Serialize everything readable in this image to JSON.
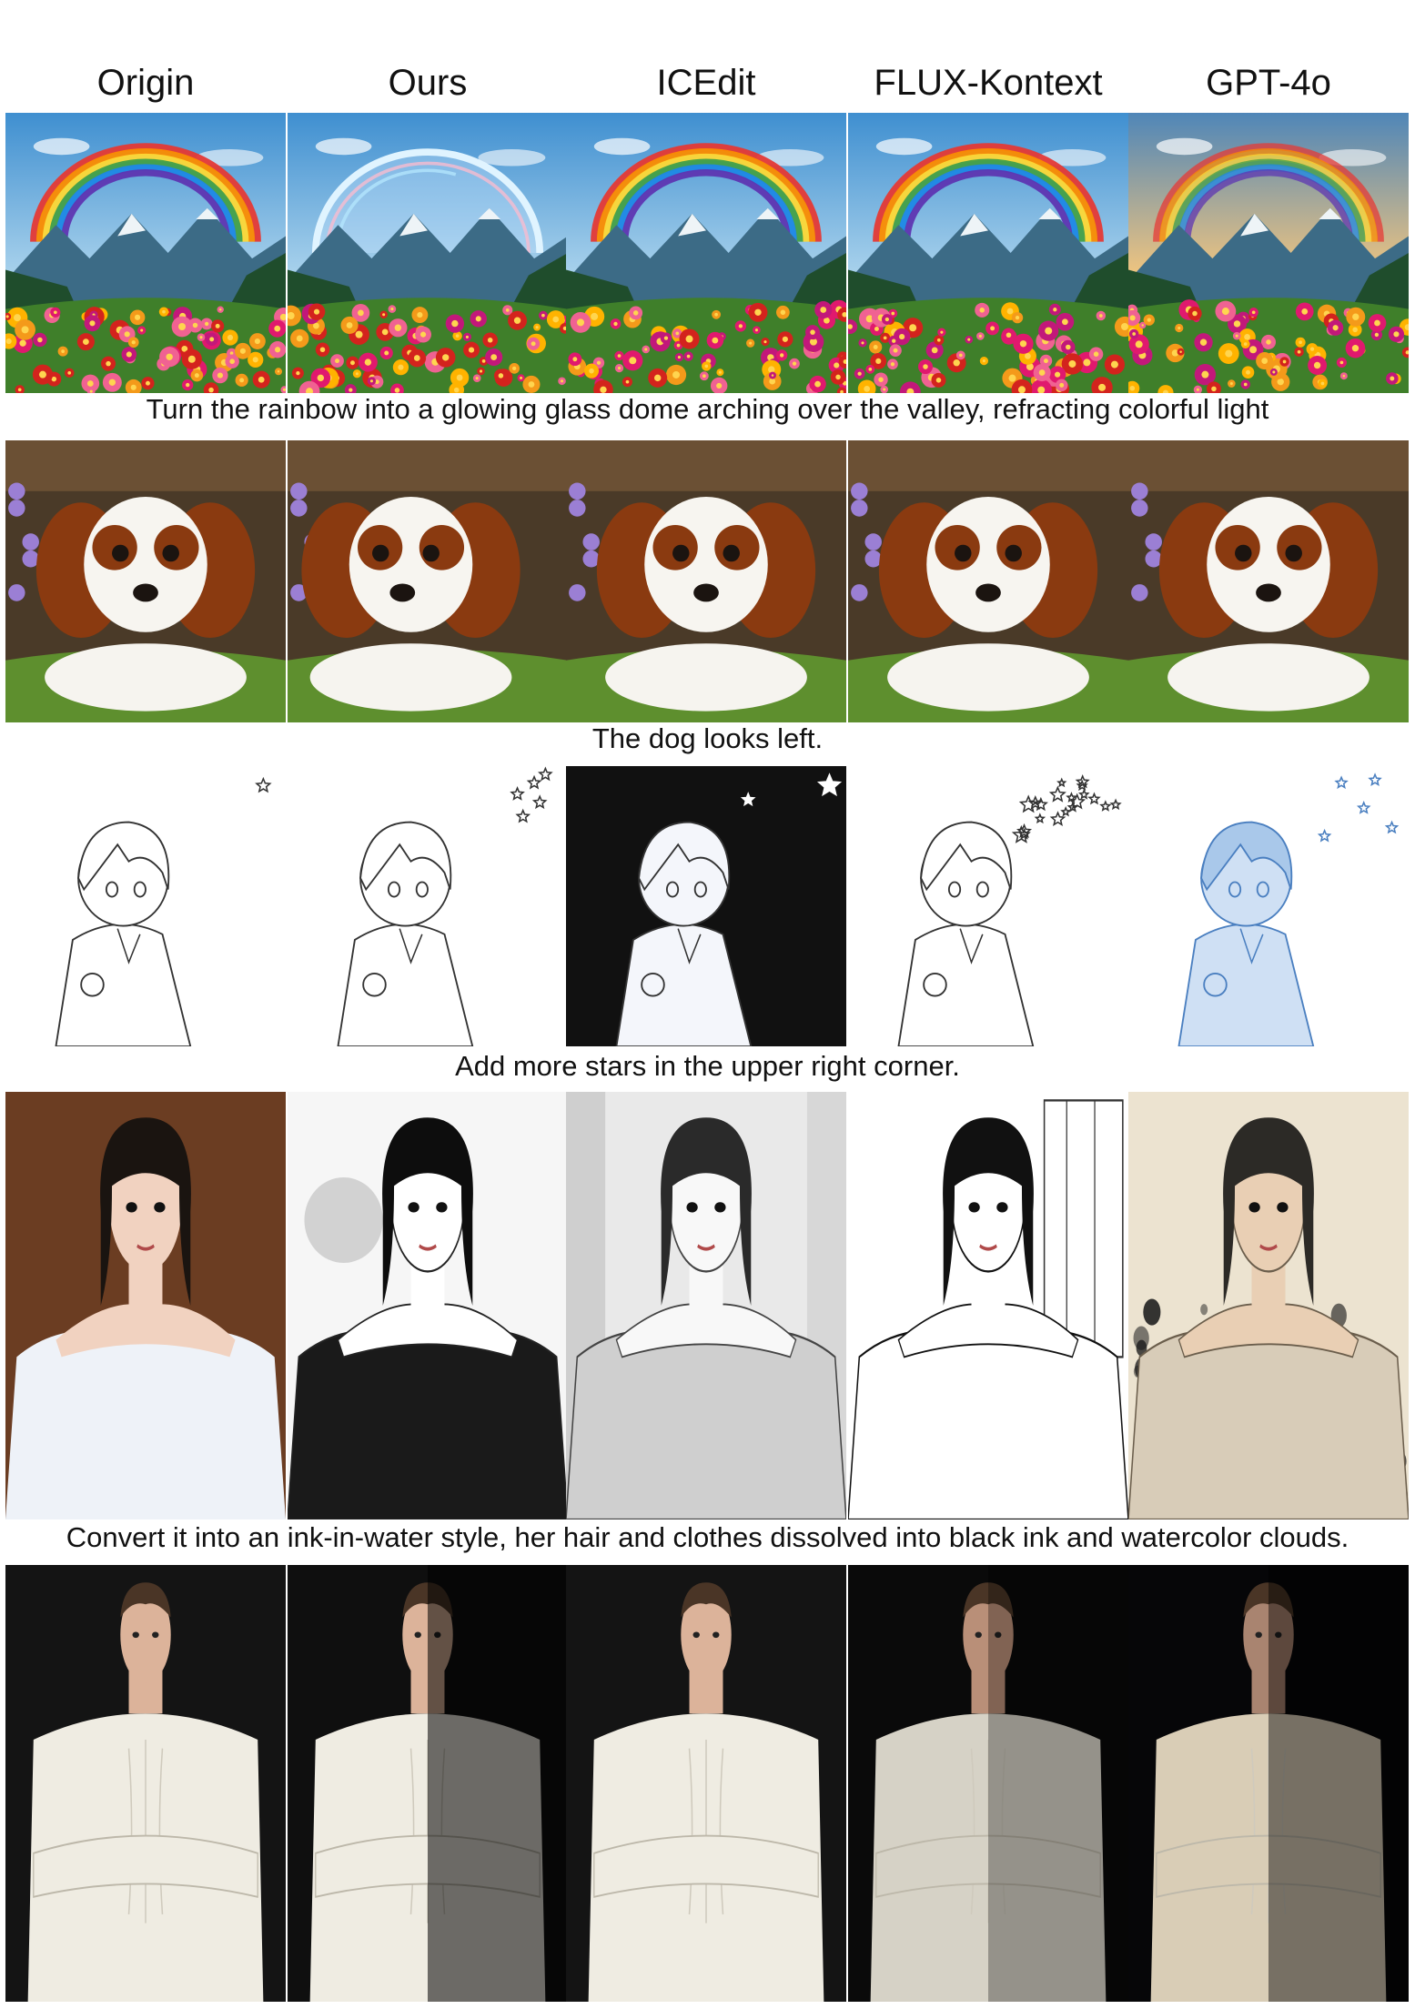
{
  "columns": [
    "Origin",
    "Ours",
    "ICEdit",
    "FLUX-Kontext",
    "GPT-4o"
  ],
  "rows": [
    {
      "caption": "Turn the rainbow into a glowing glass dome arching over the valley, refracting colorful light",
      "scene": "rainbow",
      "variants": [
        "origin",
        "glass-dome",
        "origin",
        "origin",
        "warm"
      ]
    },
    {
      "caption": "The dog looks left.",
      "scene": "dog",
      "variants": [
        "origin",
        "looks-left",
        "origin",
        "origin",
        "origin"
      ]
    },
    {
      "caption": "Add more stars in the upper right corner.",
      "scene": "sketch",
      "variants": [
        "one-star",
        "few-stars",
        "dark-bg",
        "many-stars",
        "blue"
      ]
    },
    {
      "caption": "Convert it into an ink-in-water style, her hair and clothes dissolved into black ink and watercolor clouds.",
      "scene": "portrait",
      "variants": [
        "photo",
        "ink",
        "pencil",
        "lineart",
        "watercolor"
      ]
    },
    {
      "caption": "",
      "scene": "man",
      "variants": [
        "origin",
        "side-light",
        "origin",
        "dim",
        "dark"
      ]
    }
  ],
  "colors": {
    "sky": "#5fa3d6",
    "mountain": "#3c6b86",
    "grass": "#3f7f2a",
    "flower_pink": "#e0196e",
    "flower_red": "#d3231d",
    "dog_brown": "#8a3a10",
    "ink": "#1a1a1a",
    "sweater": "#efece2"
  }
}
